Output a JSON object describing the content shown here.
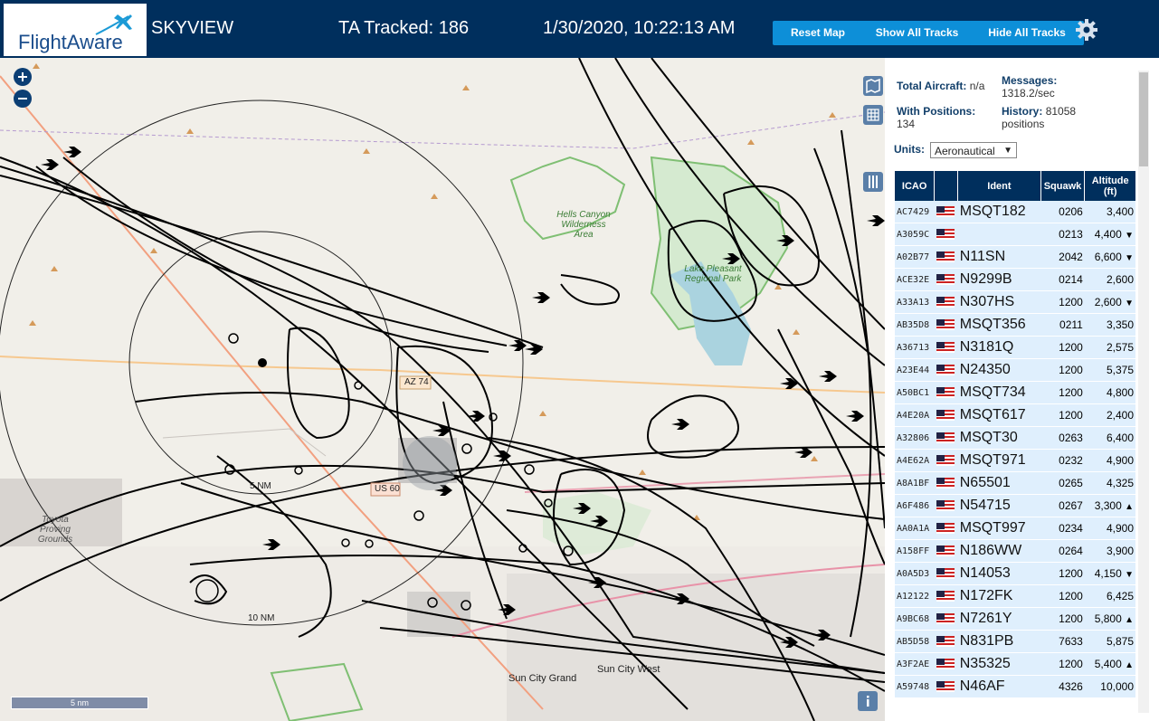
{
  "header": {
    "logo_text": "FlightAware",
    "product": "SKYVIEW",
    "tracked": "TA Tracked: 186",
    "datetime": "1/30/2020, 10:22:13 AM",
    "reset_btn": "Reset Map",
    "show_btn": "Show All Tracks",
    "hide_btn": "Hide All Tracks"
  },
  "stats": {
    "total_label": "Total Aircraft:",
    "total_value": "n/a",
    "positions_label": "With Positions:",
    "positions_value": "134",
    "messages_label": "Messages:",
    "messages_value": "1318.2/sec",
    "history_label": "History:",
    "history_value": "81058",
    "history_unit": "positions"
  },
  "units": {
    "label": "Units:",
    "selected": "Aeronautical"
  },
  "table": {
    "headers": {
      "icao": "ICAO",
      "ident": "Ident",
      "squawk": "Squawk",
      "altitude": "Altitude (ft)"
    },
    "rows": [
      {
        "icao": "AC7429",
        "ident": "MSQT182",
        "squawk": "0206",
        "alt": "3,400",
        "trend": ""
      },
      {
        "icao": "A3059C",
        "ident": "",
        "squawk": "0213",
        "alt": "4,400",
        "trend": "▼"
      },
      {
        "icao": "A02B77",
        "ident": "N11SN",
        "squawk": "2042",
        "alt": "6,600",
        "trend": "▼"
      },
      {
        "icao": "ACE32E",
        "ident": "N9299B",
        "squawk": "0214",
        "alt": "2,600",
        "trend": ""
      },
      {
        "icao": "A33A13",
        "ident": "N307HS",
        "squawk": "1200",
        "alt": "2,600",
        "trend": "▼"
      },
      {
        "icao": "AB35D8",
        "ident": "MSQT356",
        "squawk": "0211",
        "alt": "3,350",
        "trend": ""
      },
      {
        "icao": "A36713",
        "ident": "N3181Q",
        "squawk": "1200",
        "alt": "2,575",
        "trend": ""
      },
      {
        "icao": "A23E44",
        "ident": "N24350",
        "squawk": "1200",
        "alt": "5,375",
        "trend": ""
      },
      {
        "icao": "A50BC1",
        "ident": "MSQT734",
        "squawk": "1200",
        "alt": "4,800",
        "trend": ""
      },
      {
        "icao": "A4E20A",
        "ident": "MSQT617",
        "squawk": "1200",
        "alt": "2,400",
        "trend": ""
      },
      {
        "icao": "A32806",
        "ident": "MSQT30",
        "squawk": "0263",
        "alt": "6,400",
        "trend": ""
      },
      {
        "icao": "A4E62A",
        "ident": "MSQT971",
        "squawk": "0232",
        "alt": "4,900",
        "trend": ""
      },
      {
        "icao": "A8A1BF",
        "ident": "N65501",
        "squawk": "0265",
        "alt": "4,325",
        "trend": ""
      },
      {
        "icao": "A6F486",
        "ident": "N54715",
        "squawk": "0267",
        "alt": "3,300",
        "trend": "▲"
      },
      {
        "icao": "AA0A1A",
        "ident": "MSQT997",
        "squawk": "0234",
        "alt": "4,900",
        "trend": ""
      },
      {
        "icao": "A158FF",
        "ident": "N186WW",
        "squawk": "0264",
        "alt": "3,900",
        "trend": ""
      },
      {
        "icao": "A0A5D3",
        "ident": "N14053",
        "squawk": "1200",
        "alt": "4,150",
        "trend": "▼"
      },
      {
        "icao": "A12122",
        "ident": "N172FK",
        "squawk": "1200",
        "alt": "6,425",
        "trend": ""
      },
      {
        "icao": "A9BC68",
        "ident": "N7261Y",
        "squawk": "1200",
        "alt": "5,800",
        "trend": "▲"
      },
      {
        "icao": "AB5D58",
        "ident": "N831PB",
        "squawk": "7633",
        "alt": "5,875",
        "trend": ""
      },
      {
        "icao": "A3F2AE",
        "ident": "N35325",
        "squawk": "1200",
        "alt": "5,400",
        "trend": "▲"
      },
      {
        "icao": "A59748",
        "ident": "N46AF",
        "squawk": "4326",
        "alt": "10,000",
        "trend": ""
      }
    ]
  },
  "map": {
    "labels": {
      "hells_canyon": "Hells Canyon Wilderness Area",
      "lake_pleasant": "Lake Pleasant Regional Park",
      "az74": "AZ 74",
      "us60": "US 60",
      "five_nm": "5 NM",
      "ten_nm": "10 NM",
      "proving": "Toyota Proving Grounds",
      "sun_city_grand": "Sun City Grand",
      "sun_city_west": "Sun City West",
      "scale": "5 nm"
    },
    "icons": [
      "zoom-in-icon",
      "zoom-out-icon",
      "map-layer-icon",
      "grid-icon",
      "columns-icon",
      "info-icon",
      "gear-icon",
      "airplane-icon"
    ],
    "colors": {
      "header_bg": "#002f5d",
      "button": "#0d8fd8",
      "water": "#aad3df",
      "park": "#3c9b48"
    }
  }
}
